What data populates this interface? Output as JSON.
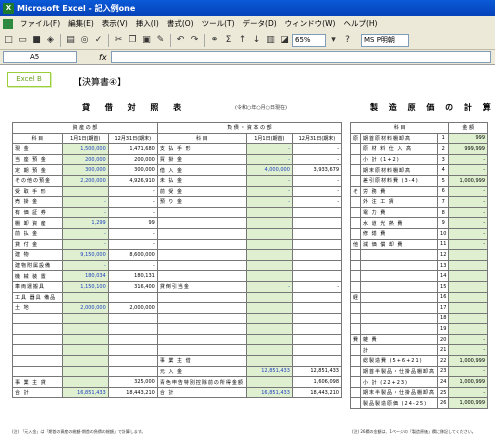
{
  "window": {
    "title": "Microsoft Excel - 記入例one"
  },
  "menu": {
    "items": [
      "ファイル(F)",
      "編集(E)",
      "表示(V)",
      "挿入(I)",
      "書式(O)",
      "ツール(T)",
      "データ(D)",
      "ウィンドウ(W)",
      "ヘルプ(H)"
    ]
  },
  "toolbar": {
    "zoom": "65%",
    "font": "MS P明朝",
    "help": "?"
  },
  "formula": {
    "cell": "A5",
    "fx": "fx"
  },
  "sheet": {
    "tag": "Excel B",
    "heading": "【決算書④】",
    "bs_title": "貸 借 対 照 表",
    "bs_note": "(令和○年○月○日現在)",
    "mc_title": "製 造 原 価 の 計 算",
    "asset_header": "資 産 の 部",
    "liab_header": "負 債 ・ 資 本 の 部",
    "col_subject": "科 目",
    "col_jan": "1月1日(期首)",
    "col_dec": "12月31日(期末)",
    "mc_col_subject": "科 目",
    "mc_col_amount": "金 額",
    "assets": [
      {
        "label": "現 金",
        "jan": "1,500,000",
        "dec": "1,471,680"
      },
      {
        "label": "当 座 預 金",
        "jan": "200,000",
        "dec": "200,000"
      },
      {
        "label": "定 期 預 金",
        "jan": "300,000",
        "dec": "300,000"
      },
      {
        "label": "その他の預金",
        "jan": "2,200,000",
        "dec": "4,926,910"
      },
      {
        "label": "受 取 手 形",
        "jan": "",
        "dec": "-"
      },
      {
        "label": "売 掛 金",
        "jan": "-",
        "dec": "-"
      },
      {
        "label": "有 価 証 券",
        "jan": "-",
        "dec": "-"
      },
      {
        "label": "棚 卸 資 産",
        "jan": "1,299",
        "dec": "99"
      },
      {
        "label": "前 払 金",
        "jan": "-",
        "dec": "-"
      },
      {
        "label": "貸 付 金",
        "jan": "-",
        "dec": "-"
      },
      {
        "label": "建 物",
        "jan": "9,150,000",
        "dec": "8,600,000"
      },
      {
        "label": "建物附属設備",
        "jan": "-",
        "dec": "-"
      },
      {
        "label": "機 械 装 置",
        "jan": "180,034",
        "dec": "180,131"
      },
      {
        "label": "車両運搬具",
        "jan": "1,150,100",
        "dec": "316,400"
      },
      {
        "label": "工具 器具 備品",
        "jan": "",
        "dec": ""
      },
      {
        "label": "土 地",
        "jan": "2,000,000",
        "dec": "2,000,000"
      },
      {
        "label": "",
        "jan": "",
        "dec": ""
      },
      {
        "label": "",
        "jan": "",
        "dec": ""
      },
      {
        "label": "",
        "jan": "",
        "dec": ""
      },
      {
        "label": "",
        "jan": "",
        "dec": ""
      },
      {
        "label": "",
        "jan": "",
        "dec": ""
      },
      {
        "label": "",
        "jan": "",
        "dec": ""
      },
      {
        "label": "事 業 主 貸",
        "jan": "",
        "dec": "325,000"
      },
      {
        "label": "合 計",
        "jan": "16,851,433",
        "dec": "18,443,210"
      }
    ],
    "liabilities": [
      {
        "label": "支 払 手 形",
        "jan": "-",
        "dec": "-"
      },
      {
        "label": "買 掛 金",
        "jan": "-",
        "dec": "-"
      },
      {
        "label": "借 入 金",
        "jan": "4,000,000",
        "dec": "3,933,679"
      },
      {
        "label": "未 払 金",
        "jan": "-",
        "dec": "-"
      },
      {
        "label": "前 受 金",
        "jan": "-",
        "dec": "-"
      },
      {
        "label": "預 り 金",
        "jan": "-",
        "dec": "-"
      },
      {
        "label": "",
        "jan": "",
        "dec": ""
      },
      {
        "label": "",
        "jan": "",
        "dec": ""
      },
      {
        "label": "",
        "jan": "",
        "dec": ""
      },
      {
        "label": "",
        "jan": "",
        "dec": ""
      },
      {
        "label": "",
        "jan": "",
        "dec": ""
      },
      {
        "label": "",
        "jan": "",
        "dec": ""
      },
      {
        "label": "",
        "jan": "",
        "dec": ""
      },
      {
        "label": "貸倒引当金",
        "jan": "-",
        "dec": "-"
      },
      {
        "label": "",
        "jan": "",
        "dec": ""
      },
      {
        "label": "",
        "jan": "",
        "dec": ""
      },
      {
        "label": "",
        "jan": "",
        "dec": ""
      },
      {
        "label": "",
        "jan": "",
        "dec": ""
      },
      {
        "label": "",
        "jan": "",
        "dec": ""
      },
      {
        "label": "",
        "jan": "",
        "dec": ""
      },
      {
        "label": "事 業 主 借",
        "jan": "",
        "dec": ""
      },
      {
        "label": "元 入 金",
        "jan": "12,851,433",
        "dec": "12,851,433"
      },
      {
        "label": "青色申告特別控除前の所得金額",
        "jan": "",
        "dec": "1,606,098"
      },
      {
        "label": "合 計",
        "jan": "16,851,433",
        "dec": "18,443,210"
      }
    ],
    "manufacturing": [
      {
        "label": "期首原材料棚卸高",
        "no": "1",
        "amount": "999"
      },
      {
        "label": "原 材 料 仕 入 高",
        "no": "2",
        "amount": "999,999"
      },
      {
        "label": "小 計 (1+2)",
        "no": "3",
        "amount": "-"
      },
      {
        "label": "期末原材料棚卸高",
        "no": "4",
        "amount": "-"
      },
      {
        "label": "差引原材料費 (3-4)",
        "no": "5",
        "amount": "1,000,999"
      },
      {
        "label": "労 務 費",
        "no": "6",
        "amount": "-"
      },
      {
        "label": "外 注 工 賃",
        "no": "7",
        "amount": "-"
      },
      {
        "label": "電 力 費",
        "no": "8",
        "amount": "-"
      },
      {
        "label": "水 道 光 熱 費",
        "no": "9",
        "amount": "-"
      },
      {
        "label": "修 繕 費",
        "no": "10",
        "amount": "-"
      },
      {
        "label": "減 価 償 却 費",
        "no": "11",
        "amount": "-"
      },
      {
        "label": "",
        "no": "12",
        "amount": ""
      },
      {
        "label": "",
        "no": "13",
        "amount": ""
      },
      {
        "label": "",
        "no": "14",
        "amount": ""
      },
      {
        "label": "",
        "no": "15",
        "amount": ""
      },
      {
        "label": "",
        "no": "16",
        "amount": ""
      },
      {
        "label": "",
        "no": "17",
        "amount": ""
      },
      {
        "label": "",
        "no": "18",
        "amount": ""
      },
      {
        "label": "",
        "no": "19",
        "amount": ""
      },
      {
        "label": "雑 費",
        "no": "20",
        "amount": "-"
      },
      {
        "label": "計",
        "no": "21",
        "amount": "-"
      },
      {
        "label": "総製造費 (5+6+21)",
        "no": "22",
        "amount": "1,000,999"
      },
      {
        "label": "期首半製品・仕掛品棚卸高",
        "no": "23",
        "amount": "-"
      },
      {
        "label": "小 計 (22+23)",
        "no": "24",
        "amount": "1,000,999"
      },
      {
        "label": "期末半製品・仕掛品棚卸高",
        "no": "25",
        "amount": "-"
      },
      {
        "label": "製品製造原価 (24-25)",
        "no": "26",
        "amount": "1,000,999"
      }
    ],
    "mc_group_other": "そ の 他 の 経 費",
    "mc_group_material": "原 材 料 費",
    "footnote_left": "(注) 「元入金」は「期首の資産の総額-期首の負債の総額」で計算します。",
    "footnote_right": "(注) 26欄の金額は、1ページの「製造原価」欄に移記してください。"
  }
}
